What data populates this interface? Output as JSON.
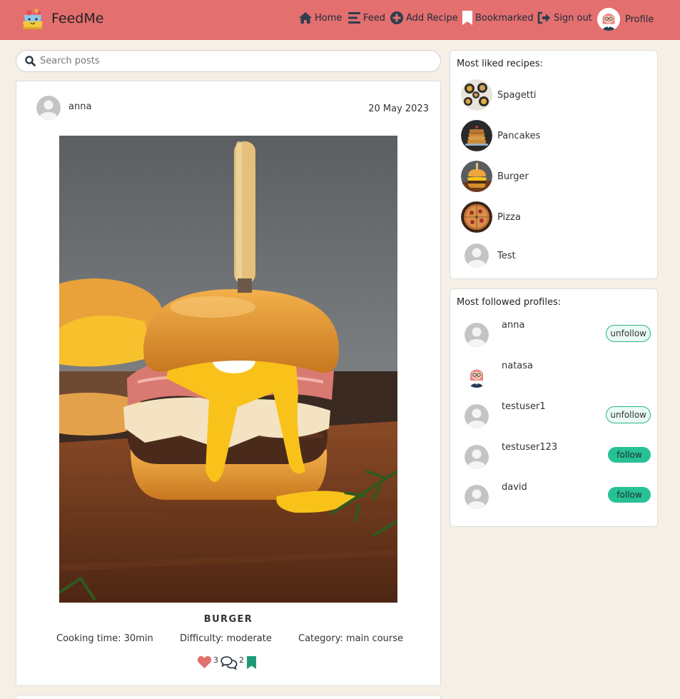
{
  "app": {
    "name": "FeedMe"
  },
  "nav": {
    "home": "Home",
    "feed": "Feed",
    "add_recipe": "Add Recipe",
    "bookmarked": "Bookmarked",
    "sign_out": "Sign out",
    "profile": "Profile"
  },
  "search": {
    "placeholder": "Search posts"
  },
  "post": {
    "author": "anna",
    "date": "20 May 2023",
    "title": "BURGER",
    "cooking_time": "Cooking time: 30min",
    "difficulty": "Difficulty: moderate",
    "category": "Category: main course",
    "likes": "3",
    "comments": "2"
  },
  "most_liked": {
    "title": "Most liked recipes:",
    "items": [
      {
        "name": "Spagetti"
      },
      {
        "name": "Pancakes"
      },
      {
        "name": "Burger"
      },
      {
        "name": "Pizza"
      },
      {
        "name": "Test"
      }
    ]
  },
  "most_followed": {
    "title": "Most followed profiles:",
    "items": [
      {
        "name": "anna",
        "button": "unfollow"
      },
      {
        "name": "natasa",
        "button": ""
      },
      {
        "name": "testuser1",
        "button": "unfollow"
      },
      {
        "name": "testuser123",
        "button": "follow"
      },
      {
        "name": "david",
        "button": "follow"
      }
    ]
  },
  "colors": {
    "navbar": "#e36f6f",
    "background": "#f5efe6",
    "accent_green": "#27c195",
    "heart": "#e36f6f"
  }
}
